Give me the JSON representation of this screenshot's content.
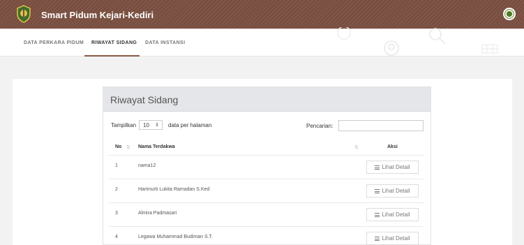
{
  "header": {
    "app_title": "Smart Pidum Kejari-Kediri",
    "logo_icon": "kejaksaan-emblem-icon",
    "avatar_icon": "user-avatar-icon",
    "bar_color": "#7a4f40"
  },
  "tabs": [
    {
      "label": "DATA PERKARA PIDUM",
      "active": false
    },
    {
      "label": "RIWAYAT SIDANG",
      "active": true
    },
    {
      "label": "DATA INSTANSI",
      "active": false
    }
  ],
  "card": {
    "title": "Riwayat Sidang",
    "show_label": "Tampilkan",
    "page_size": "10",
    "per_page_label": "data per halaman",
    "search_label": "Pencarian:",
    "search_value": "",
    "columns": {
      "no": "No",
      "name": "Nama Terdakwa",
      "action": "Aksi"
    },
    "rows": [
      {
        "no": "1",
        "name": "nama12",
        "action": "Lihat Detail"
      },
      {
        "no": "2",
        "name": "Harimurti Lukita Ramadan S.Ked",
        "action": "Lihat Detail"
      },
      {
        "no": "3",
        "name": "Almira Padmasari",
        "action": "Lihat Detail"
      },
      {
        "no": "4",
        "name": "Legawa Muhammad Budiman S.T.",
        "action": "Lihat Detail"
      }
    ]
  }
}
